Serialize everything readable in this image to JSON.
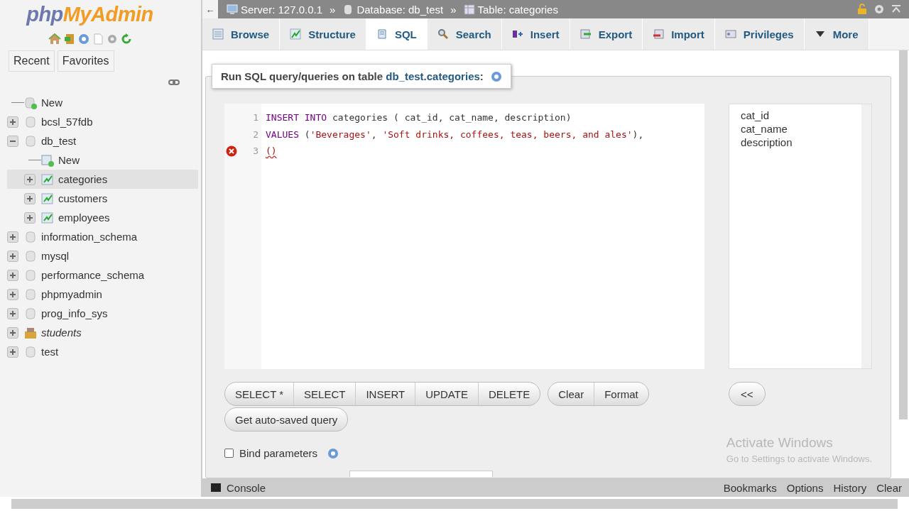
{
  "sidebar": {
    "logo": {
      "part1": "php",
      "part2": "MyAdmin"
    },
    "tabs": [
      {
        "label": "Recent"
      },
      {
        "label": "Favorites"
      }
    ],
    "tree": [
      {
        "label": "New",
        "kind": "new"
      },
      {
        "label": "bcsl_57fdb",
        "kind": "db",
        "expanded": false
      },
      {
        "label": "db_test",
        "kind": "db",
        "expanded": true,
        "children": [
          {
            "label": "New",
            "kind": "new-table"
          },
          {
            "label": "categories",
            "kind": "table",
            "expanded": false,
            "selected": true
          },
          {
            "label": "customers",
            "kind": "table",
            "expanded": false,
            "selected": false
          },
          {
            "label": "employees",
            "kind": "table",
            "expanded": false,
            "selected": false
          }
        ]
      },
      {
        "label": "information_schema",
        "kind": "db",
        "expanded": false
      },
      {
        "label": "mysql",
        "kind": "db",
        "expanded": false
      },
      {
        "label": "performance_schema",
        "kind": "db",
        "expanded": false
      },
      {
        "label": "phpmyadmin",
        "kind": "db",
        "expanded": false
      },
      {
        "label": "prog_info_sys",
        "kind": "db",
        "expanded": false
      },
      {
        "label": "students",
        "kind": "package",
        "expanded": false
      },
      {
        "label": "test",
        "kind": "db",
        "expanded": false
      }
    ]
  },
  "breadcrumb": [
    {
      "label": "Server: 127.0.0.1",
      "kind": "server"
    },
    {
      "label": "Database: db_test",
      "kind": "database"
    },
    {
      "label": "Table: categories",
      "kind": "table"
    }
  ],
  "breadcrumb_separator": "»",
  "collapse_button": "←",
  "tabs": [
    {
      "label": "Browse",
      "kind": "browse",
      "selected": false
    },
    {
      "label": "Structure",
      "kind": "structure",
      "selected": false
    },
    {
      "label": "SQL",
      "kind": "sql",
      "selected": true
    },
    {
      "label": "Search",
      "kind": "search",
      "selected": false
    },
    {
      "label": "Insert",
      "kind": "insert",
      "selected": false
    },
    {
      "label": "Export",
      "kind": "export",
      "selected": false
    },
    {
      "label": "Import",
      "kind": "import",
      "selected": false
    },
    {
      "label": "Privileges",
      "kind": "privileges",
      "selected": false
    },
    {
      "label": "More",
      "kind": "more",
      "selected": false
    }
  ],
  "query_panel": {
    "legend": "Run SQL query/queries on table **db_test.categories**:",
    "editor": {
      "lines": [
        {
          "number": "1",
          "error": false,
          "tokens": [
            {
              "text": "INSERT INTO",
              "kind": "keyword"
            },
            {
              "text": " categories ( cat_id, cat_name, description)",
              "kind": "plain"
            }
          ]
        },
        {
          "number": "2",
          "error": false,
          "tokens": [
            {
              "text": "VALUES",
              "kind": "keyword"
            },
            {
              "text": " (",
              "kind": "plain"
            },
            {
              "text": "'Beverages'",
              "kind": "string"
            },
            {
              "text": ", ",
              "kind": "plain"
            },
            {
              "text": "'Soft drinks, coffees, teas, beers, and ales'",
              "kind": "string"
            },
            {
              "text": "),",
              "kind": "plain"
            }
          ]
        },
        {
          "number": "3",
          "error": true,
          "tokens": [
            {
              "text": "()",
              "kind": "error"
            }
          ]
        }
      ]
    },
    "columns": [
      "cat_id",
      "cat_name",
      "description"
    ],
    "button_groups": [
      [
        "SELECT *",
        "SELECT",
        "INSERT",
        "UPDATE",
        "DELETE"
      ],
      [
        "Clear",
        "Format"
      ]
    ],
    "insert_button": "<<",
    "autosave_button": "Get auto-saved query",
    "bind_parameters": {
      "label": "Bind parameters",
      "checked": false
    }
  },
  "console": {
    "label": "Console",
    "links": [
      "Bookmarks",
      "Options",
      "History",
      "Clear"
    ]
  },
  "os_notice": {
    "title": "Activate Windows",
    "text": "Go to Settings to activate Windows."
  }
}
